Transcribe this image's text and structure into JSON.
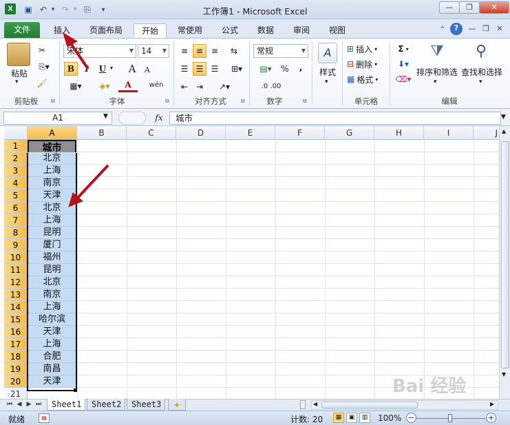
{
  "window": {
    "title": "工作簿1 - Microsoft Excel",
    "app_icon": "X",
    "controls": {
      "minimize": "—",
      "restore": "❐",
      "close": "✕"
    }
  },
  "quick_access": {
    "save": "💾",
    "undo": "↶",
    "redo": "↷",
    "extra": "⎘",
    "customize": "▾"
  },
  "tabs": [
    {
      "label": "文件"
    },
    {
      "label": "插入"
    },
    {
      "label": "页面布局"
    },
    {
      "label": "开始"
    },
    {
      "label": "常使用"
    },
    {
      "label": "公式"
    },
    {
      "label": "数据"
    },
    {
      "label": "审阅"
    },
    {
      "label": "视图"
    }
  ],
  "active_tab": "开始",
  "ribbon": {
    "clipboard": {
      "paste": "粘贴",
      "label": "剪贴板"
    },
    "font": {
      "name": "宋体",
      "size": "14",
      "bold": "B",
      "italic": "I",
      "underline": "U",
      "grow": "A",
      "shrink": "A",
      "wen": "wén",
      "font_color_letter": "A",
      "label": "字体"
    },
    "alignment": {
      "label": "对齐方式"
    },
    "number": {
      "format": "常规",
      "percent": "%",
      "comma": ",",
      "inc_dec": ".0 .00",
      "label": "数字"
    },
    "styles": {
      "label": "样式"
    },
    "cells": {
      "insert": "插入",
      "delete": "删除",
      "format": "格式",
      "label": "单元格"
    },
    "editing": {
      "sigma": "Σ",
      "sort_filter": "排序和筛选",
      "find_select": "查找和选择",
      "label": "编辑"
    }
  },
  "formula_bar": {
    "name_box": "A1",
    "fx": "fx",
    "content": "城市"
  },
  "columns": [
    "A",
    "B",
    "C",
    "D",
    "E",
    "F",
    "G",
    "H",
    "I",
    "J"
  ],
  "rows": [
    "1",
    "2",
    "3",
    "4",
    "5",
    "6",
    "7",
    "8",
    "9",
    "10",
    "11",
    "12",
    "13",
    "14",
    "15",
    "16",
    "17",
    "18",
    "19",
    "20",
    "21"
  ],
  "column_a_values": [
    "城市",
    "北京",
    "上海",
    "南京",
    "天津",
    "北京",
    "上海",
    "昆明",
    "厦门",
    "福州",
    "昆明",
    "北京",
    "南京",
    "上海",
    "哈尔滨",
    "天津",
    "上海",
    "合肥",
    "南昌",
    "天津"
  ],
  "sheets": [
    "Sheet1",
    "Sheet2",
    "Sheet3"
  ],
  "active_sheet": "Sheet1",
  "status": {
    "ready": "就绪",
    "count_label": "计数: 20",
    "zoom": "100%"
  },
  "watermark": "Bai 经验",
  "colors": {
    "accent_green": "#217a35",
    "selection": "#c6dcf2",
    "header_sel": "#f3bd4a",
    "arrow": "#b5121b"
  }
}
